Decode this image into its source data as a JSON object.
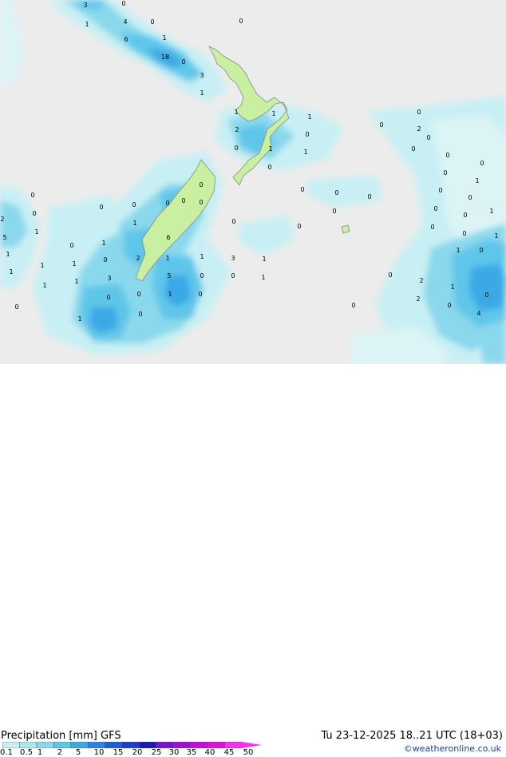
{
  "header": {
    "title": "Precipitation [mm]  GFS",
    "datetime": "Tu 23-12-2025  18..21 UTC (18+03)",
    "credit": "©weatheronline.co.uk"
  },
  "legend": {
    "ticks": [
      "0.1",
      "0.5",
      "1",
      "2",
      "5",
      "10",
      "15",
      "20",
      "25",
      "30",
      "35",
      "40",
      "45",
      "50"
    ],
    "colors": [
      "#c8f0f4",
      "#aae8f0",
      "#8ad8ec",
      "#5fc6ea",
      "#3aa9e6",
      "#2a84e0",
      "#1f5fd6",
      "#1a3fc8",
      "#1d1ab4",
      "#7a14c8",
      "#a010d0",
      "#c20ed8",
      "#e010e0",
      "#f232f0"
    ]
  },
  "map": {
    "background_color": "#ececec",
    "land_color": "#c8f0a0",
    "labels": [
      "3",
      "0",
      "0",
      "1",
      "4",
      "0",
      "6",
      "1",
      "18",
      "0",
      "3",
      "1",
      "1",
      "2",
      "0",
      "1",
      "1",
      "1",
      "0",
      "1",
      "0",
      "0",
      "0",
      "2",
      "0",
      "0",
      "0",
      "1",
      "0",
      "0",
      "0",
      "0",
      "0",
      "0",
      "1",
      "0",
      "1",
      "0",
      "1",
      "0",
      "0",
      "0",
      "0",
      "0",
      "0",
      "0",
      "0",
      "0",
      "0",
      "0",
      "0",
      "0",
      "2",
      "0",
      "0",
      "1",
      "1",
      "1",
      "1",
      "1",
      "3",
      "5",
      "0",
      "6",
      "2",
      "0",
      "1",
      "1",
      "1",
      "1",
      "1",
      "3",
      "5",
      "0",
      "0",
      "1",
      "1",
      "1",
      "0",
      "1",
      "0",
      "0",
      "0",
      "2",
      "1",
      "0",
      "2",
      "0",
      "4",
      "0",
      "0",
      "0",
      "1"
    ]
  }
}
